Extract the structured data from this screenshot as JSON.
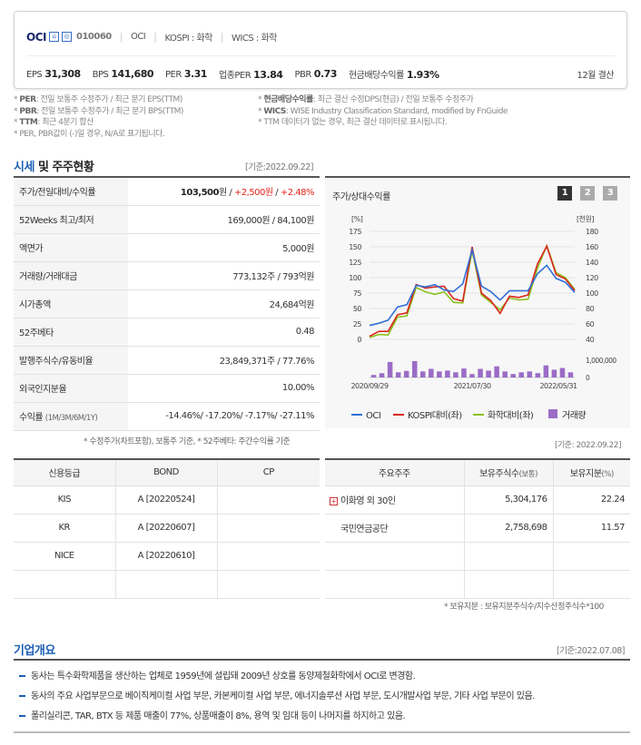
{
  "header": {
    "name": "OCI",
    "code": "010060",
    "market1": "OCI",
    "market2": "KOSPI : 화학",
    "market3": "WICS : 화학",
    "settle": "12월 결산",
    "metrics": [
      {
        "label": "EPS",
        "value": "31,308"
      },
      {
        "label": "BPS",
        "value": "141,680"
      },
      {
        "label": "PER",
        "value": "3.31"
      },
      {
        "label": "업종PER",
        "value": "13.84"
      },
      {
        "label": "PBR",
        "value": "0.73"
      },
      {
        "label": "현금배당수익률",
        "value": "1.93%"
      }
    ]
  },
  "notes_left": [
    {
      "k": "PER",
      "t": ": 전일 보통주 수정주가 / 최근 분기 EPS(TTM)"
    },
    {
      "k": "PBR",
      "t": ": 전일 보통주 수정주가 / 최근 분기 BPS(TTM)"
    },
    {
      "k": "TTM",
      "t": ": 최근 4분기 합산"
    },
    {
      "k": "",
      "t": "PER, PBR값이 (-)일 경우, N/A로 표기됩니다."
    }
  ],
  "notes_right": [
    {
      "k": "현금배당수익률",
      "t": ": 최근 결산 수정DPS(현금) / 전일 보통주 수정주가"
    },
    {
      "k": "WICS",
      "t": ": WISE Industry Classification Standard, modified by FnGuide"
    },
    {
      "k": "",
      "t": "TTM 데이터가 없는 경우, 최근 결산 데이터로 표시됩니다."
    }
  ],
  "market": {
    "title_a": "시세",
    "title_b": " 및 주주현황",
    "date": "[기준:2022.09.22]",
    "rows": [
      {
        "label": "주가/전일대비/수익률",
        "v1": "103,500",
        "u1": "원",
        "v2": "+2,500원",
        "v3": "+2.48%"
      },
      {
        "label": "52Weeks 최고/최저",
        "value": "169,000원 / 84,100원"
      },
      {
        "label": "액면가",
        "value": "5,000원"
      },
      {
        "label": "거래량/거래대금",
        "value": "773,132주 / 793억원"
      },
      {
        "label": "시가총액",
        "value": "24,684억원"
      },
      {
        "label": "52주베타",
        "value": "0.48"
      },
      {
        "label": "발행주식수/유동비율",
        "value": "23,849,371주 / 77.76%"
      },
      {
        "label": "외국인지분율",
        "value": "10.00%"
      },
      {
        "label": "수익률",
        "sub": "(1M/3M/6M/1Y)",
        "value": "-14.46%/ -17.20%/ -7.17%/ -27.11%"
      }
    ],
    "footnote": "* 수정주가(차트포함), 보통주 기준, * 52주베타: 주간수익률 기준"
  },
  "chart": {
    "title": "주가/상대수익률",
    "pages": [
      "1",
      "2",
      "3"
    ],
    "left_unit": "[%]",
    "right_unit": "[천원]",
    "vol_label": "1,000,000",
    "vol_zero": "0",
    "left_ticks": [
      "175",
      "150",
      "125",
      "100",
      "75",
      "50",
      "25",
      "0"
    ],
    "right_ticks": [
      "180",
      "160",
      "140",
      "120",
      "100",
      "80",
      "60",
      "40"
    ],
    "x_labels": [
      "2020/09/29",
      "2021/07/30",
      "2022/05/31"
    ],
    "legend": [
      {
        "name": "OCI",
        "color": "#2f6fd6"
      },
      {
        "name": "KOSPI대비(좌)",
        "color": "#d9261c"
      },
      {
        "name": "화학대비(좌)",
        "color": "#8dc21f"
      },
      {
        "name": "거래량",
        "color": "#9b6cc7"
      }
    ]
  },
  "chart_data": {
    "type": "line",
    "x": [
      "2020/09",
      "2020/10",
      "2020/11",
      "2020/12",
      "2021/01",
      "2021/02",
      "2021/03",
      "2021/04",
      "2021/05",
      "2021/06",
      "2021/07",
      "2021/08",
      "2021/09",
      "2021/10",
      "2021/11",
      "2021/12",
      "2022/01",
      "2022/02",
      "2022/03",
      "2022/04",
      "2022/05",
      "2022/06",
      "2022/07",
      "2022/08",
      "2022/09"
    ],
    "series": [
      {
        "name": "OCI",
        "axis": "right",
        "values": [
          58,
          61,
          65,
          82,
          85,
          110,
          108,
          111,
          104,
          102,
          112,
          156,
          109,
          102,
          91,
          103,
          103,
          103,
          125,
          136,
          119,
          114,
          101,
          0,
          0
        ]
      },
      {
        "name": "KOSPI대비(좌)",
        "axis": "left",
        "values": [
          5,
          13,
          13,
          40,
          43,
          89,
          83,
          85,
          86,
          66,
          62,
          150,
          75,
          63,
          42,
          70,
          68,
          72,
          122,
          151,
          105,
          98,
          79,
          0,
          0
        ]
      },
      {
        "name": "화학대비(좌)",
        "axis": "left",
        "values": [
          3,
          8,
          7,
          36,
          38,
          84,
          77,
          73,
          77,
          60,
          59,
          144,
          72,
          60,
          48,
          67,
          64,
          65,
          115,
          152,
          108,
          100,
          81,
          0,
          0
        ]
      },
      {
        "name": "거래량",
        "axis": "volume",
        "values": [
          150000,
          250000,
          900000,
          300000,
          380000,
          950000,
          350000,
          500000,
          350000,
          400000,
          300000,
          520000,
          200000,
          500000,
          400000,
          650000,
          350000,
          200000,
          300000,
          350000,
          250000,
          700000,
          450000,
          550000,
          300000
        ]
      }
    ],
    "ylim_left": [
      0,
      175
    ],
    "ylim_right": [
      40,
      180
    ]
  },
  "credit": {
    "headers": [
      "신용등급",
      "BOND",
      "CP"
    ],
    "rows": [
      [
        "KIS",
        "A [20220524]",
        ""
      ],
      [
        "KR",
        "A [20220607]",
        ""
      ],
      [
        "NICE",
        "A [20220610]",
        ""
      ],
      [
        "",
        "",
        ""
      ]
    ]
  },
  "shareholders": {
    "date": "[기준: 2022.09.22]",
    "headers": [
      "주요주주",
      "보유주식수",
      "(보통)",
      "보유지분",
      "(%)"
    ],
    "rows": [
      [
        "이화영 외 30인",
        "5,304,176",
        "22.24"
      ],
      [
        "국민연금공단",
        "2,758,698",
        "11.57"
      ],
      [
        "",
        "",
        ""
      ],
      [
        "",
        "",
        ""
      ]
    ],
    "footnote": "* 보유지분 : 보유지분주식수/지수산정주식수*100"
  },
  "overview": {
    "title": "기업개요",
    "date": "[기준:2022.07.08]",
    "items": [
      "동사는 특수화학제품을 생산하는 업체로 1959년에 설립돼 2009년 상호를 동양제철화학에서 OCI로 변경함.",
      "동사의 주요 사업부문으로 베이직케미컬 사업 부문, 카본케미컬 사업 부문, 에너지솔루션 사업 부문, 도시개발사업 부문, 기타 사업 부문이 있음.",
      "폴리실리콘, TAR, BTX 등 제품 매출이 77%, 상품매출이 8%, 용역 및 임대 등이 나머지를 하지하고 있음."
    ]
  }
}
